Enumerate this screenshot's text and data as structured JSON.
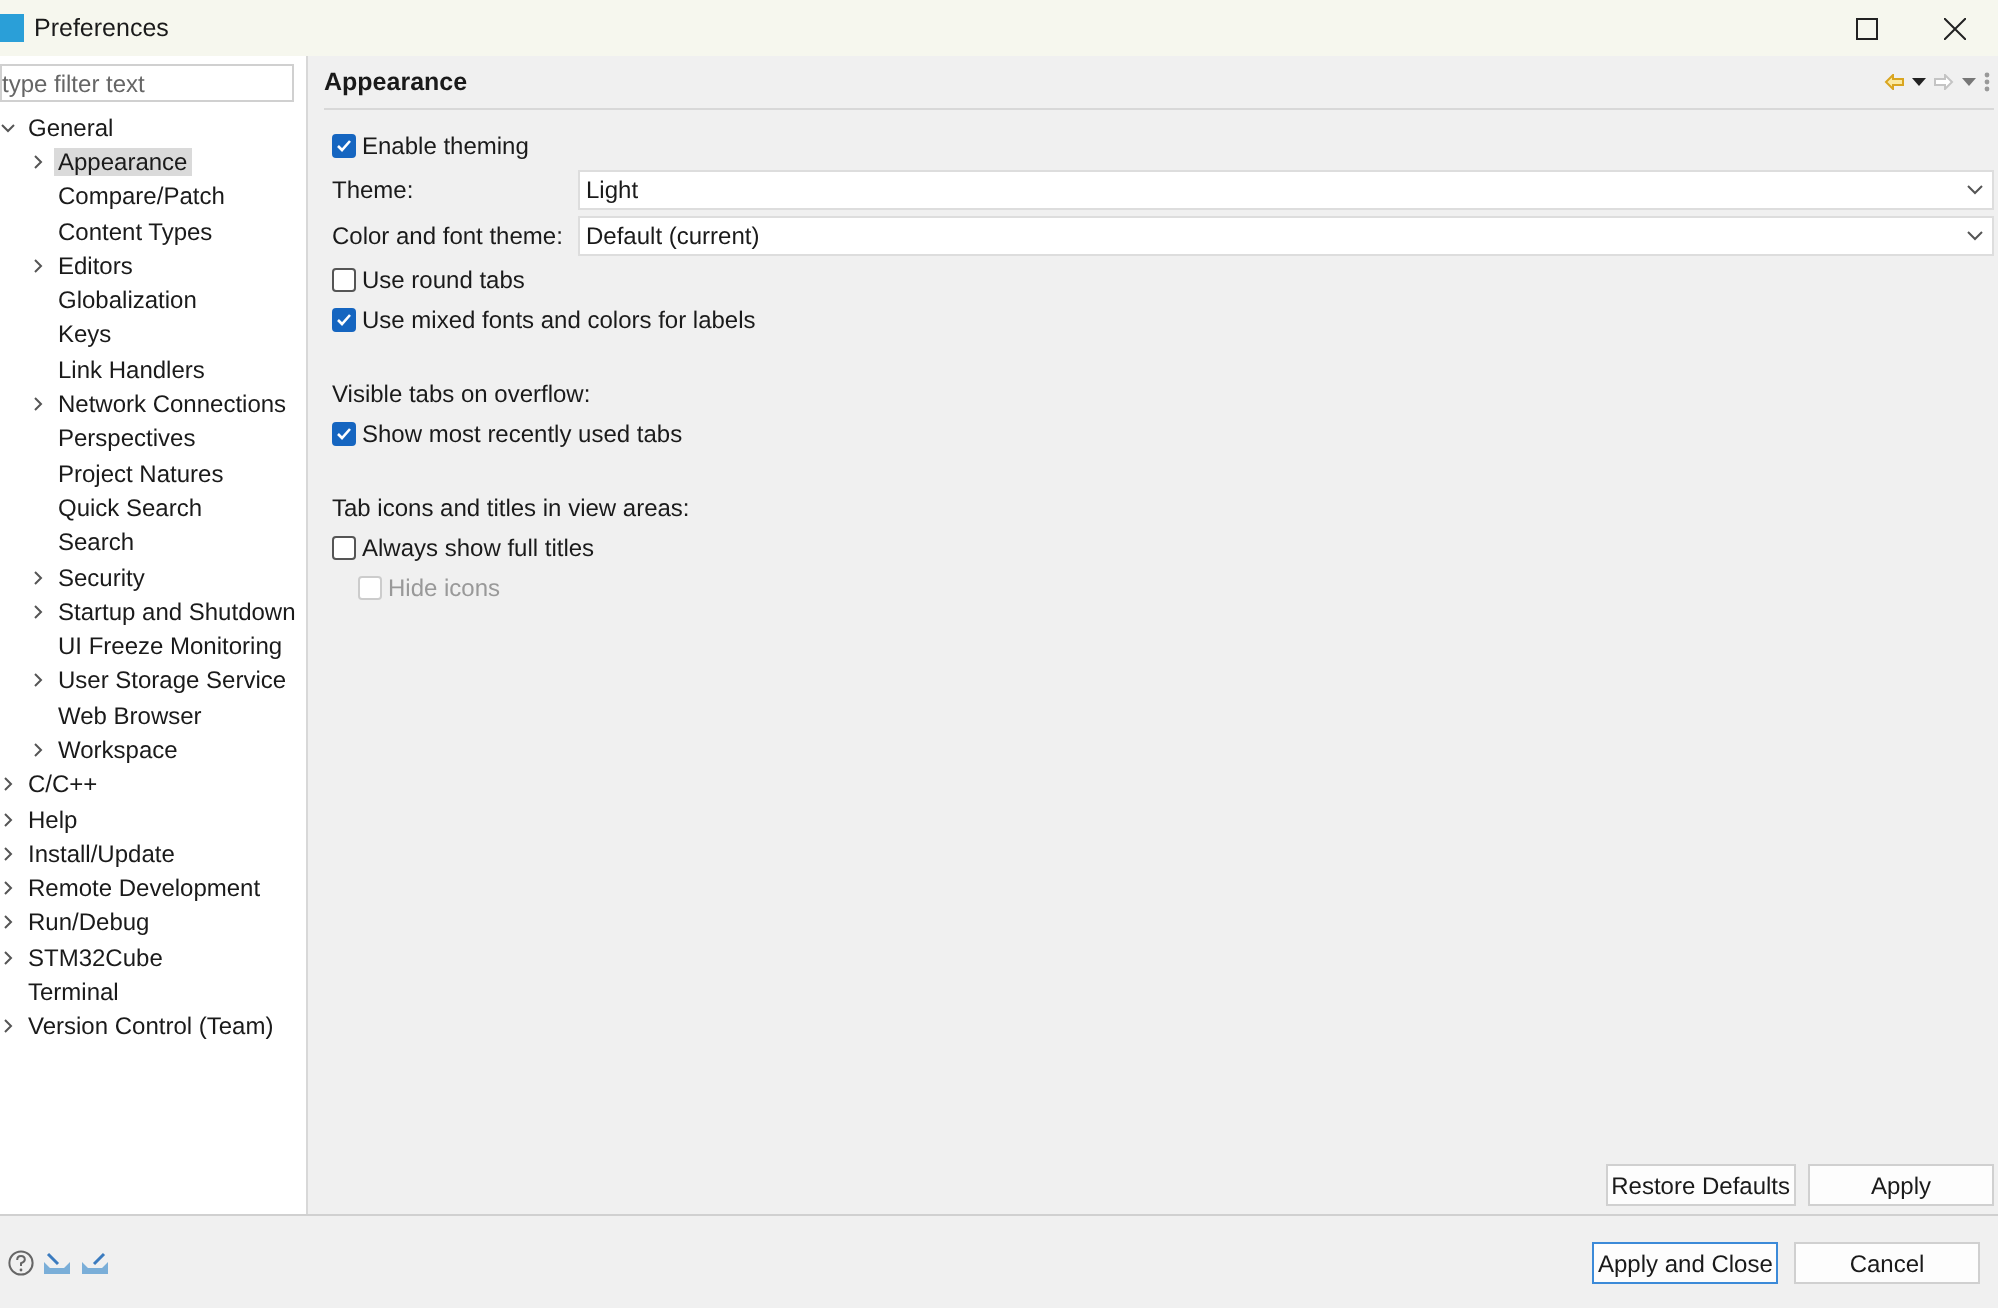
{
  "window": {
    "title": "Preferences"
  },
  "filter": {
    "placeholder": "type filter text"
  },
  "tree": [
    {
      "label": "General",
      "expanded": true,
      "selected": false,
      "children": [
        {
          "label": "Appearance",
          "expanded": false,
          "selected": true
        },
        {
          "label": "Compare/Patch",
          "selected": false
        },
        {
          "label": "Content Types",
          "selected": false
        },
        {
          "label": "Editors",
          "expanded": false,
          "selected": false
        },
        {
          "label": "Globalization",
          "selected": false
        },
        {
          "label": "Keys",
          "selected": false
        },
        {
          "label": "Link Handlers",
          "selected": false
        },
        {
          "label": "Network Connections",
          "expanded": false,
          "selected": false
        },
        {
          "label": "Perspectives",
          "selected": false
        },
        {
          "label": "Project Natures",
          "selected": false
        },
        {
          "label": "Quick Search",
          "selected": false
        },
        {
          "label": "Search",
          "selected": false
        },
        {
          "label": "Security",
          "expanded": false,
          "selected": false
        },
        {
          "label": "Startup and Shutdown",
          "expanded": false,
          "selected": false
        },
        {
          "label": "UI Freeze Monitoring",
          "selected": false
        },
        {
          "label": "User Storage Service",
          "expanded": false,
          "selected": false
        },
        {
          "label": "Web Browser",
          "selected": false
        },
        {
          "label": "Workspace",
          "expanded": false,
          "selected": false
        }
      ]
    },
    {
      "label": "C/C++",
      "expanded": false,
      "selected": false
    },
    {
      "label": "Help",
      "expanded": false,
      "selected": false
    },
    {
      "label": "Install/Update",
      "expanded": false,
      "selected": false
    },
    {
      "label": "Remote Development",
      "expanded": false,
      "selected": false
    },
    {
      "label": "Run/Debug",
      "expanded": false,
      "selected": false
    },
    {
      "label": "STM32Cube",
      "expanded": false,
      "selected": false
    },
    {
      "label": "Terminal",
      "selected": false
    },
    {
      "label": "Version Control (Team)",
      "expanded": false,
      "selected": false
    }
  ],
  "page": {
    "title": "Appearance",
    "rows": [
      {
        "kind": "checkbox",
        "label": "Enable theming",
        "checked": true,
        "disabled": false
      },
      {
        "kind": "select",
        "label": "Theme:",
        "value": "Light"
      },
      {
        "kind": "select",
        "label": "Color and font theme:",
        "value": "Default (current)"
      },
      {
        "kind": "checkbox",
        "label": "Use round tabs",
        "checked": false,
        "disabled": false
      },
      {
        "kind": "checkbox",
        "label": "Use mixed fonts and colors for labels",
        "checked": true,
        "disabled": false
      },
      {
        "kind": "spacer"
      },
      {
        "kind": "heading",
        "label": "Visible tabs on overflow:"
      },
      {
        "kind": "checkbox",
        "label": "Show most recently used tabs",
        "checked": true,
        "disabled": false
      },
      {
        "kind": "spacer"
      },
      {
        "kind": "heading",
        "label": "Tab icons and titles in view areas:"
      },
      {
        "kind": "checkbox",
        "label": "Always show full titles",
        "checked": false,
        "disabled": false
      },
      {
        "kind": "subcheckbox",
        "label": "Hide icons",
        "checked": false,
        "disabled": true
      }
    ],
    "buttons": [
      "Restore Defaults",
      "Apply"
    ]
  },
  "footer": {
    "buttons": [
      {
        "label": "Apply and Close",
        "selected": true
      },
      {
        "label": "Cancel",
        "selected": false
      }
    ]
  }
}
